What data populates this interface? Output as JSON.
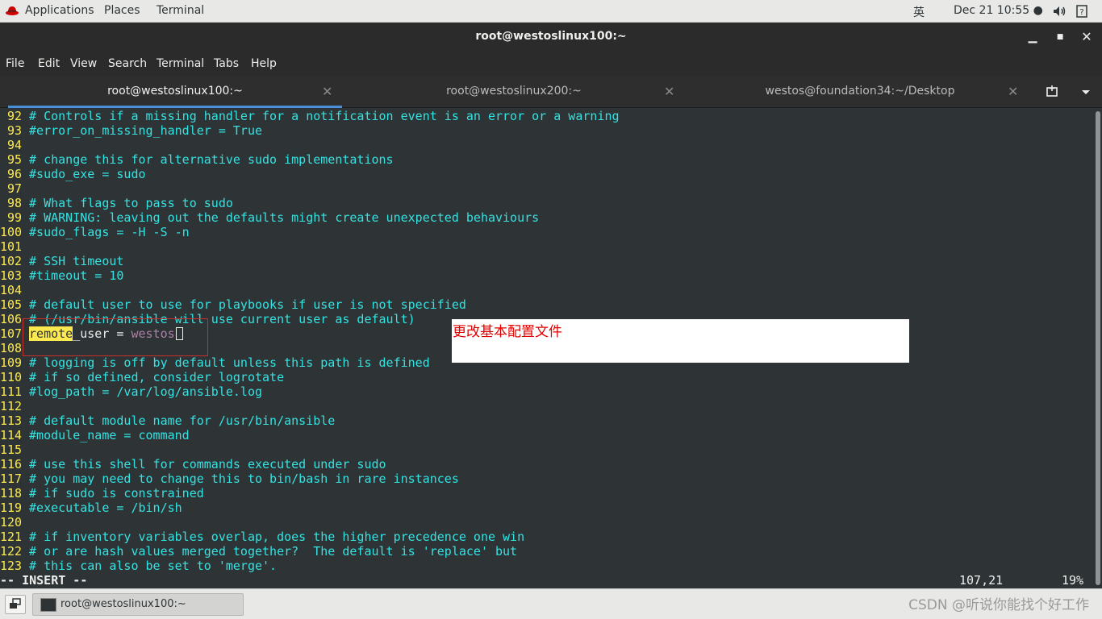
{
  "topbar": {
    "applications": "Applications",
    "places": "Places",
    "terminal": "Terminal",
    "input_method": "英",
    "datetime": "Dec 21  10:55 ●"
  },
  "window": {
    "title": "root@westoslinux100:~"
  },
  "menu": [
    "File",
    "Edit",
    "View",
    "Search",
    "Terminal",
    "Tabs",
    "Help"
  ],
  "tabs": [
    {
      "label": "root@westoslinux100:~",
      "active": true
    },
    {
      "label": "root@westoslinux200:~",
      "active": false
    },
    {
      "label": "westos@foundation34:~/Desktop",
      "active": false
    }
  ],
  "lines": [
    {
      "n": "92",
      "text": "# Controls if a missing handler for a notification event is an error or a warning"
    },
    {
      "n": "93",
      "text": "#error_on_missing_handler = True"
    },
    {
      "n": "94",
      "text": ""
    },
    {
      "n": "95",
      "text": "# change this for alternative sudo implementations"
    },
    {
      "n": "96",
      "text": "#sudo_exe = sudo"
    },
    {
      "n": "97",
      "text": ""
    },
    {
      "n": "98",
      "text": "# What flags to pass to sudo"
    },
    {
      "n": "99",
      "text": "# WARNING: leaving out the defaults might create unexpected behaviours"
    },
    {
      "n": "100",
      "text": "#sudo_flags = -H -S -n"
    },
    {
      "n": "101",
      "text": ""
    },
    {
      "n": "102",
      "text": "# SSH timeout"
    },
    {
      "n": "103",
      "text": "#timeout = 10"
    },
    {
      "n": "104",
      "text": ""
    },
    {
      "n": "105",
      "text": "# default user to use for playbooks if user is not specified"
    },
    {
      "n": "106",
      "text": "# (/usr/bin/ansible will use current user as default)"
    },
    {
      "n": "107",
      "text": ""
    },
    {
      "n": "108",
      "text": ""
    },
    {
      "n": "109",
      "text": "# logging is off by default unless this path is defined"
    },
    {
      "n": "110",
      "text": "# if so defined, consider logrotate"
    },
    {
      "n": "111",
      "text": "#log_path = /var/log/ansible.log"
    },
    {
      "n": "112",
      "text": ""
    },
    {
      "n": "113",
      "text": "# default module name for /usr/bin/ansible"
    },
    {
      "n": "114",
      "text": "#module_name = command"
    },
    {
      "n": "115",
      "text": ""
    },
    {
      "n": "116",
      "text": "# use this shell for commands executed under sudo"
    },
    {
      "n": "117",
      "text": "# you may need to change this to bin/bash in rare instances"
    },
    {
      "n": "118",
      "text": "# if sudo is constrained"
    },
    {
      "n": "119",
      "text": "#executable = /bin/sh"
    },
    {
      "n": "120",
      "text": ""
    },
    {
      "n": "121",
      "text": "# if inventory variables overlap, does the higher precedence one win"
    },
    {
      "n": "122",
      "text": "# or are hash values merged together?  The default is 'replace' but"
    },
    {
      "n": "123",
      "text": "# this can also be set to 'merge'."
    }
  ],
  "edited_line": {
    "highlight": "remote",
    "key_rest": "_user = ",
    "value": "westos"
  },
  "status": {
    "mode": "-- INSERT --",
    "position": "107,21",
    "percent": "19%"
  },
  "annotation": {
    "note": "更改基本配置文件"
  },
  "taskbar": {
    "item": "root@westoslinux100:~"
  },
  "watermark": "CSDN @听说你能找个好工作",
  "colors": {
    "background": "#2e3436",
    "line_number": "#fce94f",
    "comment": "#34e2e2",
    "value": "#ad7fa8",
    "accent": "#4a90d9"
  }
}
